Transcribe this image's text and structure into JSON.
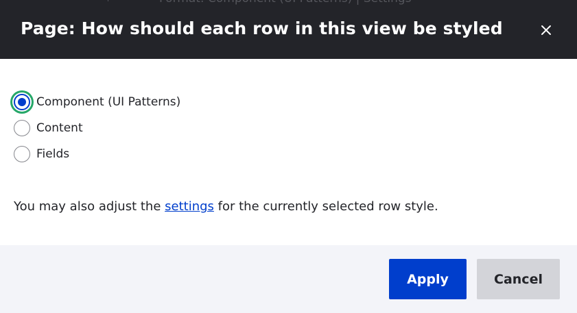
{
  "background_page": {
    "partial_text": "Format: Component (UI Patterns) | Settings"
  },
  "dialog": {
    "title": "Page: How should each row in this view be styled",
    "close_icon": "close-icon"
  },
  "row_style": {
    "options": [
      {
        "label": "Component (UI Patterns)",
        "checked": true
      },
      {
        "label": "Content",
        "checked": false
      },
      {
        "label": "Fields",
        "checked": false
      }
    ]
  },
  "help": {
    "before": "You may also adjust the ",
    "link": "settings",
    "after": " for the currently selected row style."
  },
  "footer": {
    "apply_label": "Apply",
    "cancel_label": "Cancel"
  },
  "colors": {
    "titlebar": "#232429",
    "primary": "#003ecc",
    "focus_ring": "#26a769",
    "footer_bg": "#f3f4f9",
    "cancel_bg": "#d3d4d9"
  }
}
